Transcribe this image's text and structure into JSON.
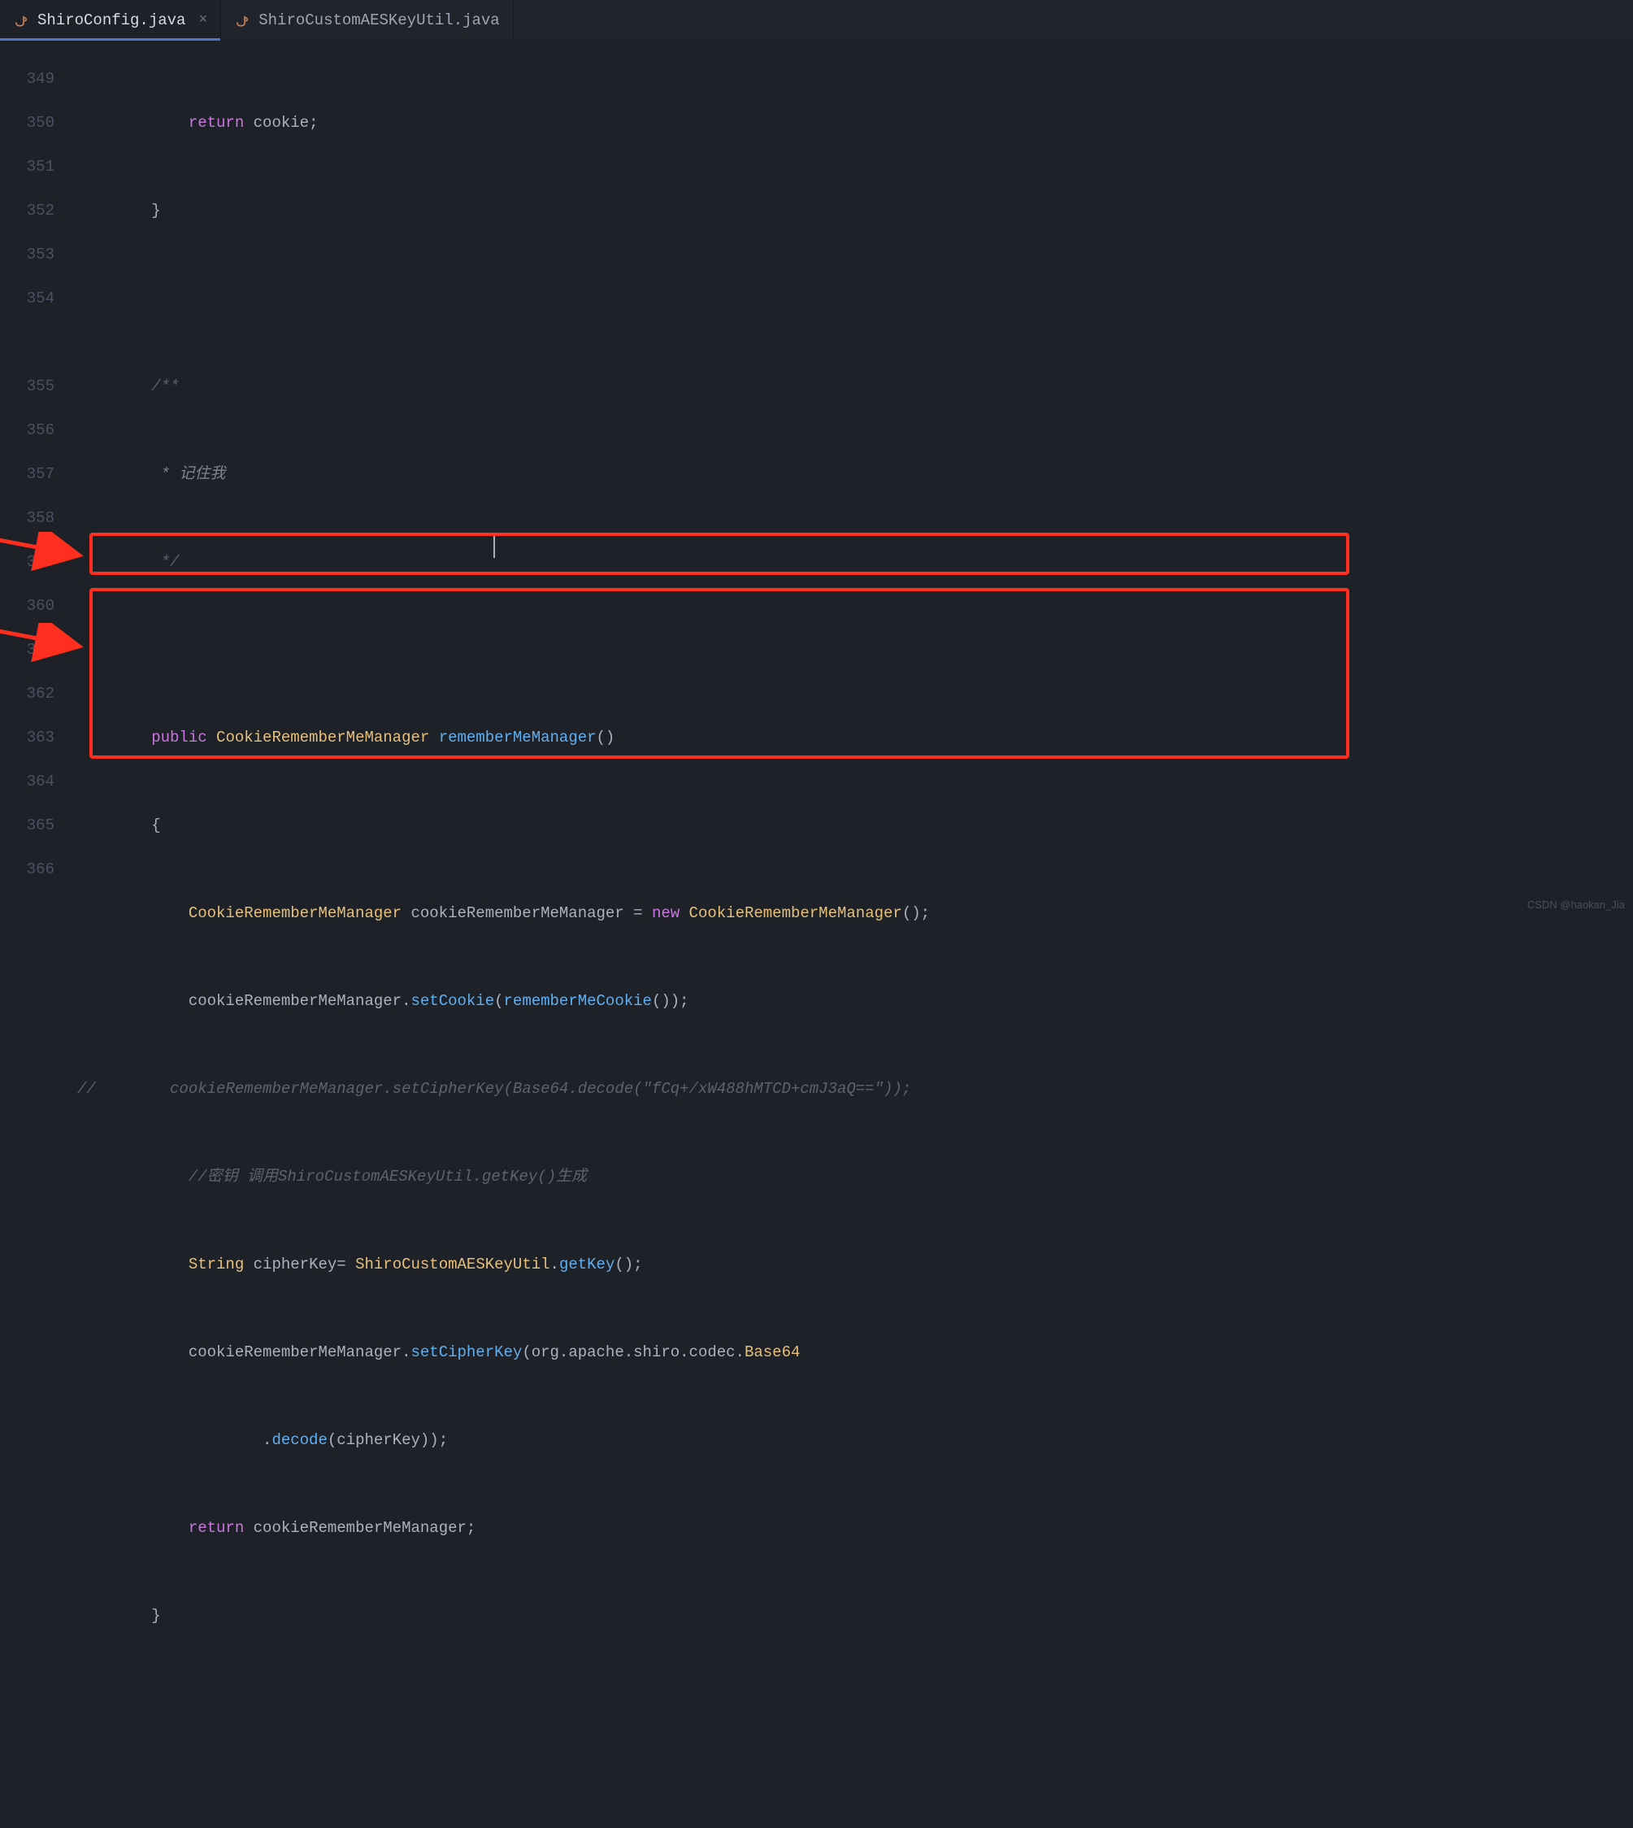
{
  "tabs": [
    {
      "label": "ShiroConfig.java",
      "active": true
    },
    {
      "label": "ShiroCustomAESKeyUtil.java",
      "active": false
    }
  ],
  "gutter": [
    "349",
    "350",
    "351",
    "352",
    "353",
    "354",
    "",
    "355",
    "356",
    "357",
    "358",
    "359",
    "360",
    "361",
    "362",
    "363",
    "364",
    "365",
    "366"
  ],
  "code": {
    "l349_return": "return",
    "l349_cookie": " cookie;",
    "l350": "        }",
    "l352_c": "/**",
    "l353_c": " * 记住我",
    "l354_c": " */",
    "l355_public": "public",
    "l355_type": " CookieRememberMeManager ",
    "l355_method": "rememberMeManager",
    "l355_paren": "()",
    "l356": "        {",
    "l357_type1": "CookieRememberMeManager",
    "l357_var": " cookieRememberMeManager ",
    "l357_eq": "= ",
    "l357_new": "new",
    "l357_type2": " CookieRememberMeManager",
    "l357_end": "();",
    "l358_obj": "cookieRememberMeManager.",
    "l358_m": "setCookie",
    "l358_arg1": "(",
    "l358_call": "rememberMeCookie",
    "l358_end": "());",
    "l359_slash": "//",
    "l359_txt1": "        cookieRememberMeManager",
    "l359_txt2": ".setCipherKey(Base64.decode(\"fCq+/xW488hMTCD+cmJ3aQ==\"));",
    "l360_c": "//密钥 调用ShiroCustomAESKeyUtil.getKey()生成",
    "l361_type": "String",
    "l361_var": " cipherKey",
    "l361_eq": "= ",
    "l361_cls": "ShiroCustomAESKeyUtil",
    "l361_dot": ".",
    "l361_m": "getKey",
    "l361_end": "();",
    "l362_obj": "cookieRememberMeManager.",
    "l362_m": "setCipherKey",
    "l362_arg": "(org.apache.shiro.codec.",
    "l362_cls": "Base64",
    "l363_dot": ".",
    "l363_m": "decode",
    "l363_arg": "(cipherKey));",
    "l364_return": "return",
    "l364_v": " cookieRememberMeManager;",
    "l365": "        }"
  },
  "watermark": "CSDN @haokan_Jia"
}
